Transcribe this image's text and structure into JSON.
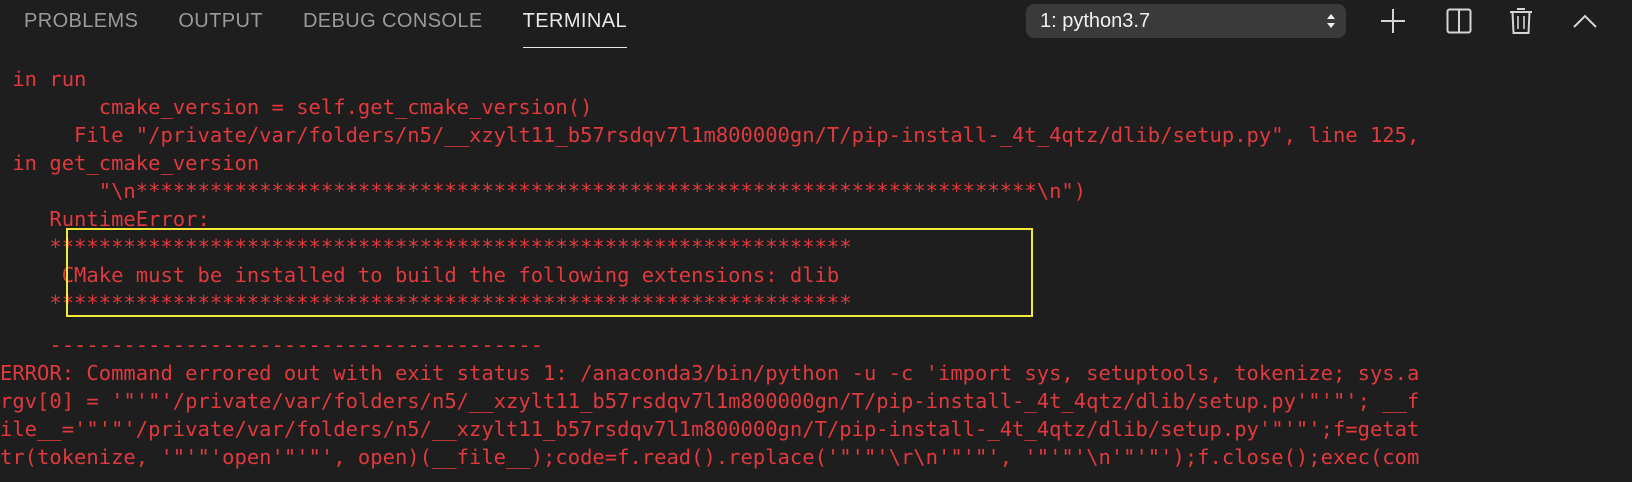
{
  "panel": {
    "tabs": [
      {
        "label": "PROBLEMS"
      },
      {
        "label": "OUTPUT"
      },
      {
        "label": "DEBUG CONSOLE"
      },
      {
        "label": "TERMINAL"
      }
    ],
    "active_tab": "TERMINAL",
    "terminal_selector": {
      "value": "1: python3.7"
    },
    "icons": [
      "plus-icon",
      "split-icon",
      "trash-icon",
      "chevron-up-icon"
    ]
  },
  "terminal": {
    "lines": [
      " in run",
      "        cmake_version = self.get_cmake_version()",
      "      File \"/private/var/folders/n5/__xzylt11_b57rsdqv7l1m800000gn/T/pip-install-_4t_4qtz/dlib/setup.py\", line 125,",
      " in get_cmake_version",
      "        \"\\n*************************************************************************\\n\")",
      "    RuntimeError:",
      "    *****************************************************************",
      "     CMake must be installed to build the following extensions: dlib",
      "    *****************************************************************",
      "",
      "    ----------------------------------------",
      "ERROR: Command errored out with exit status 1: /anaconda3/bin/python -u -c 'import sys, setuptools, tokenize; sys.a",
      "rgv[0] = '\"'\"'/private/var/folders/n5/__xzylt11_b57rsdqv7l1m800000gn/T/pip-install-_4t_4qtz/dlib/setup.py'\"'\"'; __f",
      "ile__='\"'\"'/private/var/folders/n5/__xzylt11_b57rsdqv7l1m800000gn/T/pip-install-_4t_4qtz/dlib/setup.py'\"'\"';f=getat",
      "tr(tokenize, '\"'\"'open'\"'\"', open)(__file__);code=f.read().replace('\"'\"'\\r\\n'\"'\"', '\"'\"'\\n'\"'\"');f.close();exec(com"
    ]
  },
  "colors": {
    "background": "#1e1e1e",
    "error_text": "#e0393e",
    "highlight_border": "#f2ea3a",
    "active_tab": "#e8e8e8",
    "inactive_tab": "#9a9a9a",
    "select_bg": "#3a3a3a"
  }
}
